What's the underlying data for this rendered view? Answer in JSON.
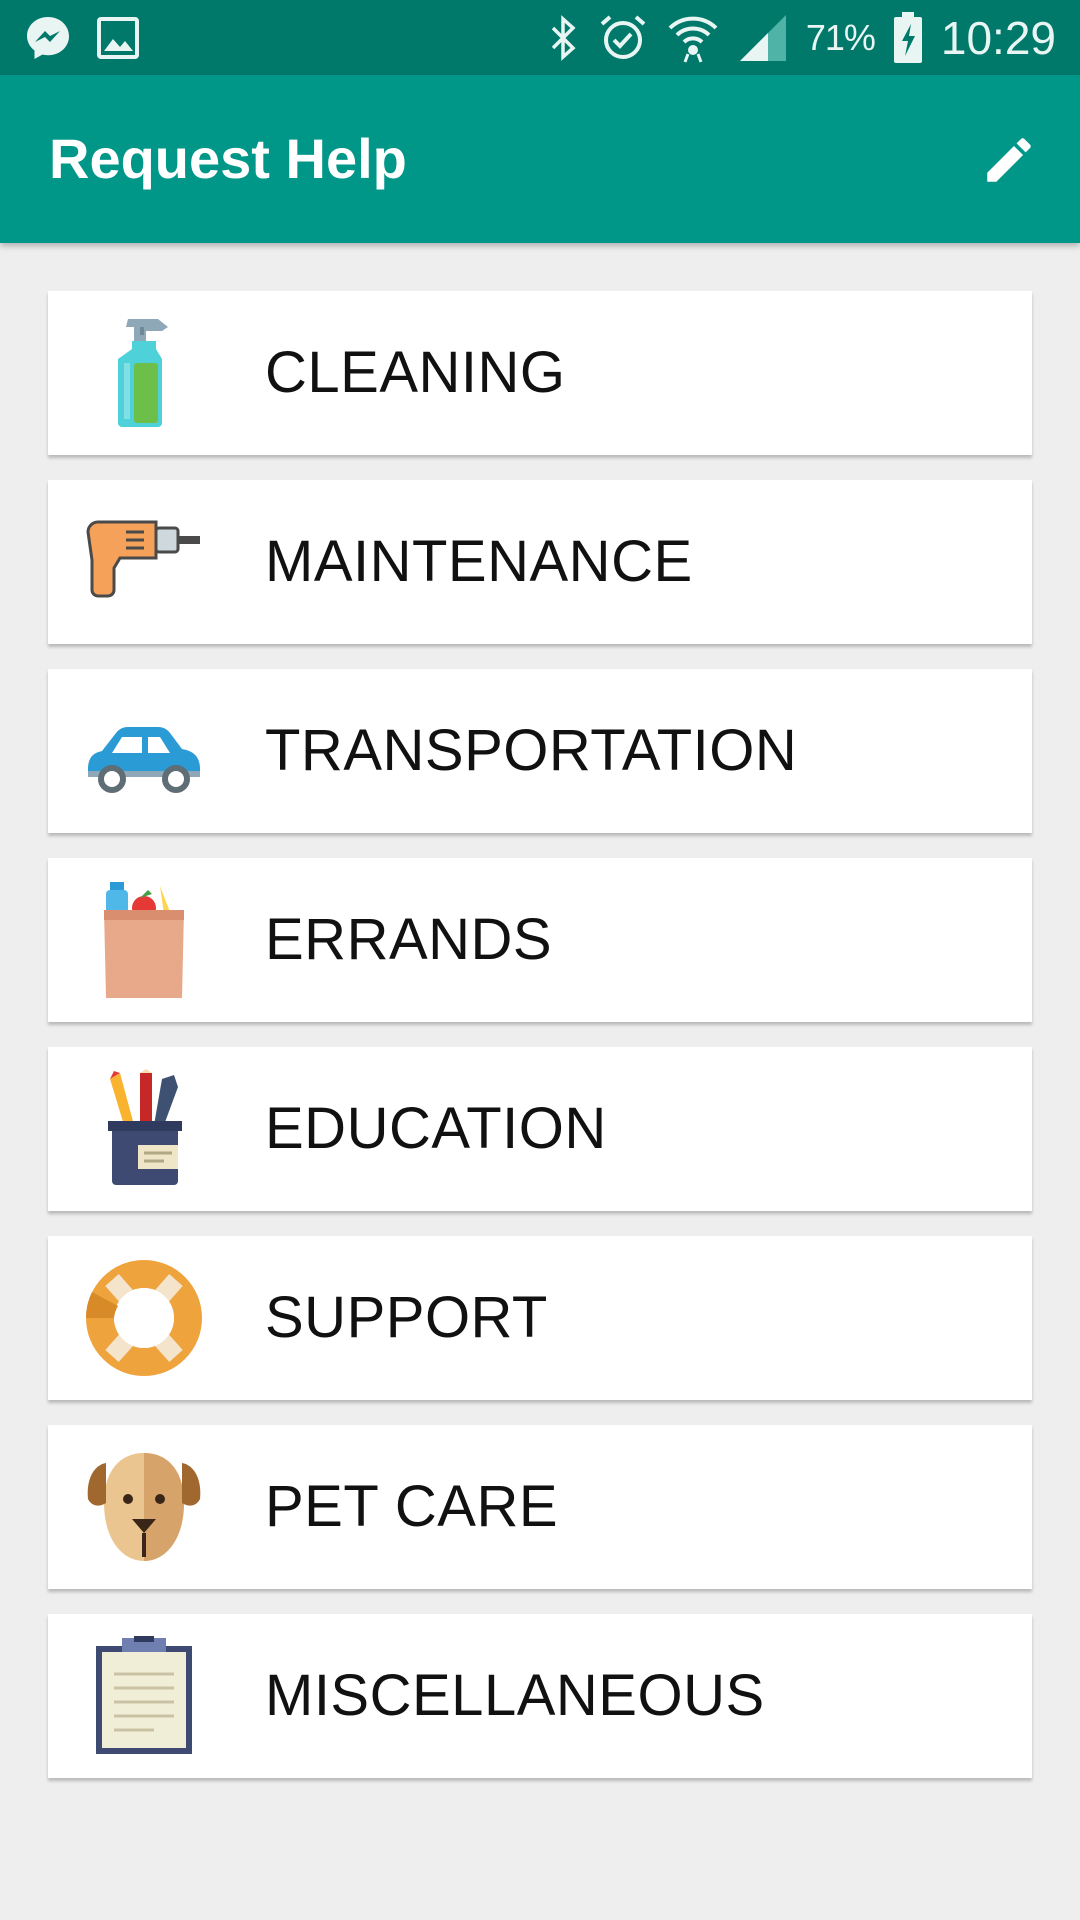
{
  "status_bar": {
    "battery": "71%",
    "time": "10:29",
    "icons": [
      "messenger-icon",
      "gallery-icon",
      "bluetooth-icon",
      "alarm-icon",
      "wifi-icon",
      "signal-icon",
      "battery-charging-icon"
    ]
  },
  "app_bar": {
    "title": "Request Help",
    "action_icon": "edit-icon",
    "background_color": "#009688",
    "status_bar_color": "#00796b"
  },
  "categories": [
    {
      "label": "CLEANING",
      "icon": "spray-bottle-icon"
    },
    {
      "label": "MAINTENANCE",
      "icon": "drill-icon"
    },
    {
      "label": "TRANSPORTATION",
      "icon": "car-icon"
    },
    {
      "label": "ERRANDS",
      "icon": "grocery-bag-icon"
    },
    {
      "label": "EDUCATION",
      "icon": "pencil-cup-icon"
    },
    {
      "label": "SUPPORT",
      "icon": "lifebuoy-icon"
    },
    {
      "label": "PET CARE",
      "icon": "dog-icon"
    },
    {
      "label": "MISCELLANEOUS",
      "icon": "clipboard-icon"
    }
  ]
}
